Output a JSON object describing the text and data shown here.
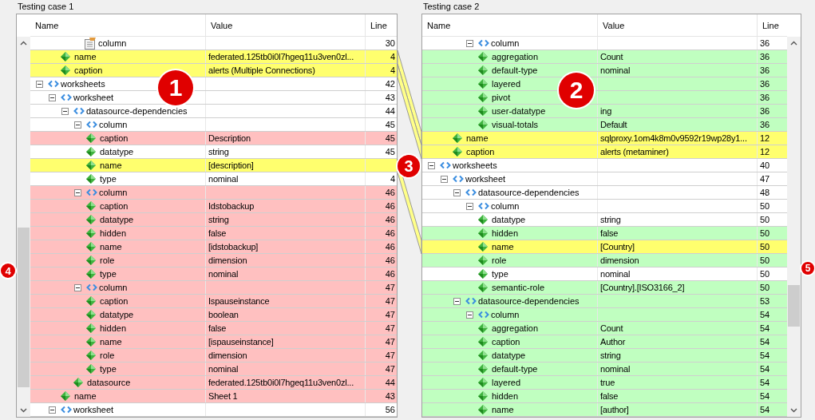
{
  "panels": [
    {
      "title": "Testing case 1",
      "columns": [
        "Name",
        "Value",
        "Line"
      ],
      "rows": [
        {
          "children": [
            {
              "children": [
                {
                  "children": [
                    {
                      "name": "column",
                      "kind": "table",
                      "line": "30",
                      "color": "#ffffff"
                    }
                  ]
                },
                {
                  "name": "name",
                  "kind": "attribute",
                  "value": "federated.125tb0i0l7hgeq11u3ven0zl...",
                  "line": "4",
                  "color": "#ffff6e"
                },
                {
                  "name": "caption",
                  "kind": "attribute",
                  "value": "alerts (Multiple Connections)",
                  "line": "4",
                  "color": "#ffff6e"
                }
              ]
            }
          ]
        },
        {
          "name": "worksheets",
          "kind": "element",
          "expanded": true,
          "line": "42",
          "color": "#ffffff",
          "children": [
            {
              "name": "worksheet",
              "kind": "element",
              "expanded": true,
              "line": "43",
              "color": "#ffffff",
              "children": [
                {
                  "name": "datasource-dependencies",
                  "kind": "element",
                  "expanded": true,
                  "line": "44",
                  "color": "#ffffff",
                  "children": [
                    {
                      "name": "column",
                      "kind": "element",
                      "expanded": true,
                      "line": "45",
                      "color": "#ffffff",
                      "children": [
                        {
                          "name": "caption",
                          "kind": "attribute",
                          "value": "Description",
                          "line": "45",
                          "color": "#ffc0c0"
                        },
                        {
                          "name": "datatype",
                          "kind": "attribute",
                          "value": "string",
                          "line": "45",
                          "color": "#ffffff"
                        },
                        {
                          "name": "name",
                          "kind": "attribute",
                          "value": "[description]",
                          "color": "#ffff6e"
                        },
                        {
                          "name": "type",
                          "kind": "attribute",
                          "value": "nominal",
                          "line": "4",
                          "color": "#ffffff"
                        }
                      ]
                    },
                    {
                      "name": "column",
                      "kind": "element",
                      "expanded": true,
                      "line": "46",
                      "color": "#ffc0c0",
                      "children": [
                        {
                          "name": "caption",
                          "kind": "attribute",
                          "value": "Idstobackup",
                          "line": "46",
                          "color": "#ffc0c0"
                        },
                        {
                          "name": "datatype",
                          "kind": "attribute",
                          "value": "string",
                          "line": "46",
                          "color": "#ffc0c0"
                        },
                        {
                          "name": "hidden",
                          "kind": "attribute",
                          "value": "false",
                          "line": "46",
                          "color": "#ffc0c0"
                        },
                        {
                          "name": "name",
                          "kind": "attribute",
                          "value": "[idstobackup]",
                          "line": "46",
                          "color": "#ffc0c0"
                        },
                        {
                          "name": "role",
                          "kind": "attribute",
                          "value": "dimension",
                          "line": "46",
                          "color": "#ffc0c0"
                        },
                        {
                          "name": "type",
                          "kind": "attribute",
                          "value": "nominal",
                          "line": "46",
                          "color": "#ffc0c0"
                        }
                      ]
                    },
                    {
                      "name": "column",
                      "kind": "element",
                      "expanded": true,
                      "line": "47",
                      "color": "#ffc0c0",
                      "children": [
                        {
                          "name": "caption",
                          "kind": "attribute",
                          "value": "Ispauseinstance",
                          "line": "47",
                          "color": "#ffc0c0"
                        },
                        {
                          "name": "datatype",
                          "kind": "attribute",
                          "value": "boolean",
                          "line": "47",
                          "color": "#ffc0c0"
                        },
                        {
                          "name": "hidden",
                          "kind": "attribute",
                          "value": "false",
                          "line": "47",
                          "color": "#ffc0c0"
                        },
                        {
                          "name": "name",
                          "kind": "attribute",
                          "value": "[ispauseinstance]",
                          "line": "47",
                          "color": "#ffc0c0"
                        },
                        {
                          "name": "role",
                          "kind": "attribute",
                          "value": "dimension",
                          "line": "47",
                          "color": "#ffc0c0"
                        },
                        {
                          "name": "type",
                          "kind": "attribute",
                          "value": "nominal",
                          "line": "47",
                          "color": "#ffc0c0"
                        }
                      ]
                    },
                    {
                      "name": "datasource",
                      "kind": "attribute",
                      "value": "federated.125tb0i0l7hgeq11u3ven0zl...",
                      "line": "44",
                      "color": "#ffc0c0"
                    }
                  ]
                },
                {
                  "name": "name",
                  "kind": "attribute",
                  "value": "Sheet 1",
                  "line": "43",
                  "color": "#ffc0c0"
                }
              ]
            },
            {
              "name": "worksheet",
              "kind": "element",
              "expanded": true,
              "line": "56",
              "color": "#ffffff"
            }
          ]
        }
      ]
    },
    {
      "title": "Testing case 2",
      "columns": [
        "Name",
        "Value",
        "Line"
      ],
      "rows": [
        {
          "children": [
            {
              "children": [
                {
                  "children": [
                    {
                      "name": "column",
                      "kind": "element",
                      "expanded": true,
                      "line": "36",
                      "color": "#ffffff",
                      "children": [
                        {
                          "name": "aggregation",
                          "kind": "attribute",
                          "value": "Count",
                          "line": "36",
                          "color": "#c0ffc0"
                        },
                        {
                          "name": "default-type",
                          "kind": "attribute",
                          "value": "nominal",
                          "line": "36",
                          "color": "#c0ffc0"
                        },
                        {
                          "name": "layered",
                          "kind": "attribute",
                          "line": "36",
                          "color": "#c0ffc0"
                        },
                        {
                          "name": "pivot",
                          "kind": "attribute",
                          "line": "36",
                          "color": "#c0ffc0"
                        },
                        {
                          "name": "user-datatype",
                          "kind": "attribute",
                          "value": "ing",
                          "line": "36",
                          "color": "#c0ffc0"
                        },
                        {
                          "name": "visual-totals",
                          "kind": "attribute",
                          "value": "Default",
                          "line": "36",
                          "color": "#c0ffc0"
                        }
                      ]
                    }
                  ]
                },
                {
                  "name": "name",
                  "kind": "attribute",
                  "value": "sqlproxy.1om4k8m0v9592r19wp28y1...",
                  "line": "12",
                  "color": "#ffff6e"
                },
                {
                  "name": "caption",
                  "kind": "attribute",
                  "value": "alerts (metaminer)",
                  "line": "12",
                  "color": "#ffff6e"
                }
              ]
            }
          ]
        },
        {
          "name": "worksheets",
          "kind": "element",
          "expanded": true,
          "line": "40",
          "color": "#ffffff",
          "children": [
            {
              "name": "worksheet",
              "kind": "element",
              "expanded": true,
              "line": "47",
              "color": "#ffffff",
              "children": [
                {
                  "name": "datasource-dependencies",
                  "kind": "element",
                  "expanded": true,
                  "line": "48",
                  "color": "#ffffff",
                  "children": [
                    {
                      "name": "column",
                      "kind": "element",
                      "expanded": true,
                      "line": "50",
                      "color": "#ffffff",
                      "children": [
                        {
                          "name": "datatype",
                          "kind": "attribute",
                          "value": "string",
                          "line": "50",
                          "color": "#ffffff"
                        },
                        {
                          "name": "hidden",
                          "kind": "attribute",
                          "value": "false",
                          "line": "50",
                          "color": "#c0ffc0"
                        },
                        {
                          "name": "name",
                          "kind": "attribute",
                          "value": "[Country]",
                          "line": "50",
                          "color": "#ffff6e"
                        },
                        {
                          "name": "role",
                          "kind": "attribute",
                          "value": "dimension",
                          "line": "50",
                          "color": "#c0ffc0"
                        },
                        {
                          "name": "type",
                          "kind": "attribute",
                          "value": "nominal",
                          "line": "50",
                          "color": "#ffffff"
                        },
                        {
                          "name": "semantic-role",
                          "kind": "attribute",
                          "value": "[Country].[ISO3166_2]",
                          "line": "50",
                          "color": "#c0ffc0"
                        }
                      ]
                    }
                  ]
                },
                {
                  "name": "datasource-dependencies",
                  "kind": "element",
                  "expanded": true,
                  "line": "53",
                  "color": "#c0ffc0",
                  "children": [
                    {
                      "name": "column",
                      "kind": "element",
                      "expanded": true,
                      "line": "54",
                      "color": "#c0ffc0",
                      "children": [
                        {
                          "name": "aggregation",
                          "kind": "attribute",
                          "value": "Count",
                          "line": "54",
                          "color": "#c0ffc0"
                        },
                        {
                          "name": "caption",
                          "kind": "attribute",
                          "value": "Author",
                          "line": "54",
                          "color": "#c0ffc0"
                        },
                        {
                          "name": "datatype",
                          "kind": "attribute",
                          "value": "string",
                          "line": "54",
                          "color": "#c0ffc0"
                        },
                        {
                          "name": "default-type",
                          "kind": "attribute",
                          "value": "nominal",
                          "line": "54",
                          "color": "#c0ffc0"
                        },
                        {
                          "name": "layered",
                          "kind": "attribute",
                          "value": "true",
                          "line": "54",
                          "color": "#c0ffc0"
                        },
                        {
                          "name": "hidden",
                          "kind": "attribute",
                          "value": "false",
                          "line": "54",
                          "color": "#c0ffc0"
                        },
                        {
                          "name": "name",
                          "kind": "attribute",
                          "value": "[author]",
                          "line": "54",
                          "color": "#c0ffc0"
                        }
                      ]
                    }
                  ]
                }
              ]
            }
          ]
        }
      ]
    }
  ],
  "badges": [
    "1",
    "2",
    "3",
    "4",
    "5"
  ]
}
